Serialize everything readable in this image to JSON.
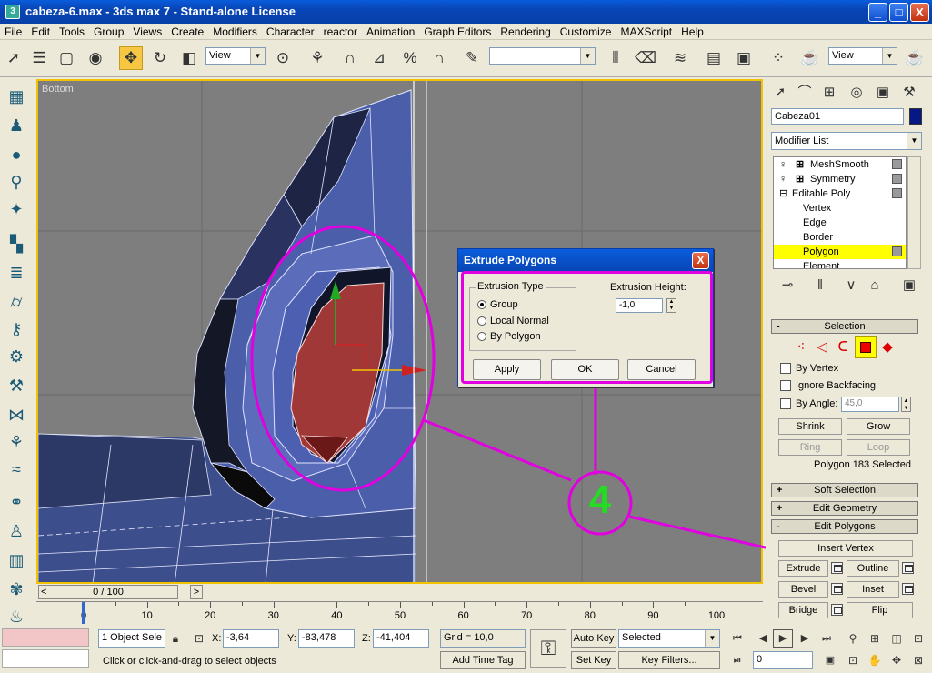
{
  "window": {
    "title": "cabeza-6.max - 3ds max 7 - Stand-alone License",
    "minimize": "_",
    "maximize": "□",
    "close": "X"
  },
  "menu": [
    "File",
    "Edit",
    "Tools",
    "Group",
    "Views",
    "Create",
    "Modifiers",
    "Character",
    "reactor",
    "Animation",
    "Graph Editors",
    "Rendering",
    "Customize",
    "MAXScript",
    "Help"
  ],
  "toolbar": {
    "ref_coord_left": "View",
    "ref_coord_right": "View",
    "angle_snap": "3",
    "percent_snap": "%"
  },
  "viewport": {
    "label": "Bottom"
  },
  "annotation": {
    "number": "4",
    "color": "#E000E0",
    "number_color": "#22DD22"
  },
  "dialog": {
    "title": "Extrude Polygons",
    "close": "X",
    "extrusion_type_label": "Extrusion Type",
    "options": [
      "Group",
      "Local Normal",
      "By Polygon"
    ],
    "selected_option": "Group",
    "extrusion_height_label": "Extrusion Height:",
    "extrusion_height_value": "-1,0",
    "buttons": {
      "apply": "Apply",
      "ok": "OK",
      "cancel": "Cancel"
    }
  },
  "command_panel": {
    "object_name": "Cabeza01",
    "object_color": "#071786",
    "modifier_list": "Modifier List",
    "stack": [
      {
        "label": "MeshSmooth",
        "level": 0,
        "icon": "+"
      },
      {
        "label": "Symmetry",
        "level": 0,
        "icon": "+"
      },
      {
        "label": "Editable Poly",
        "level": 0,
        "icon": "-"
      },
      {
        "label": "Vertex",
        "level": 1
      },
      {
        "label": "Edge",
        "level": 1
      },
      {
        "label": "Border",
        "level": 1
      },
      {
        "label": "Polygon",
        "level": 1,
        "selected": true
      },
      {
        "label": "Element",
        "level": 1
      }
    ],
    "selection": {
      "title": "Selection",
      "by_vertex": "By Vertex",
      "ignore_backfacing": "Ignore Backfacing",
      "by_angle": "By Angle:",
      "angle_value": "45,0",
      "shrink": "Shrink",
      "grow": "Grow",
      "ring": "Ring",
      "loop": "Loop",
      "status": "Polygon 183 Selected"
    },
    "soft_selection": "Soft Selection",
    "edit_geometry": "Edit Geometry",
    "edit_polygons": {
      "title": "Edit Polygons",
      "insert_vertex": "Insert Vertex",
      "extrude": "Extrude",
      "outline": "Outline",
      "bevel": "Bevel",
      "inset": "Inset",
      "bridge": "Bridge",
      "flip": "Flip"
    }
  },
  "time": {
    "frame_display": "0 / 100",
    "ticks": [
      "0",
      "10",
      "20",
      "30",
      "40",
      "50",
      "60",
      "70",
      "80",
      "90",
      "100"
    ]
  },
  "status": {
    "selection": "1 Object Sele",
    "x_label": "X:",
    "x": "-3,64",
    "y_label": "Y:",
    "y": "-83,478",
    "z_label": "Z:",
    "z": "-41,404",
    "grid": "Grid = 10,0",
    "prompt": "Click or click-and-drag to select objects",
    "add_time_tag": "Add Time Tag",
    "auto_key": "Auto Key",
    "set_key": "Set Key",
    "key_mode": "Selected",
    "key_filters": "Key Filters...",
    "current_frame": "0"
  }
}
